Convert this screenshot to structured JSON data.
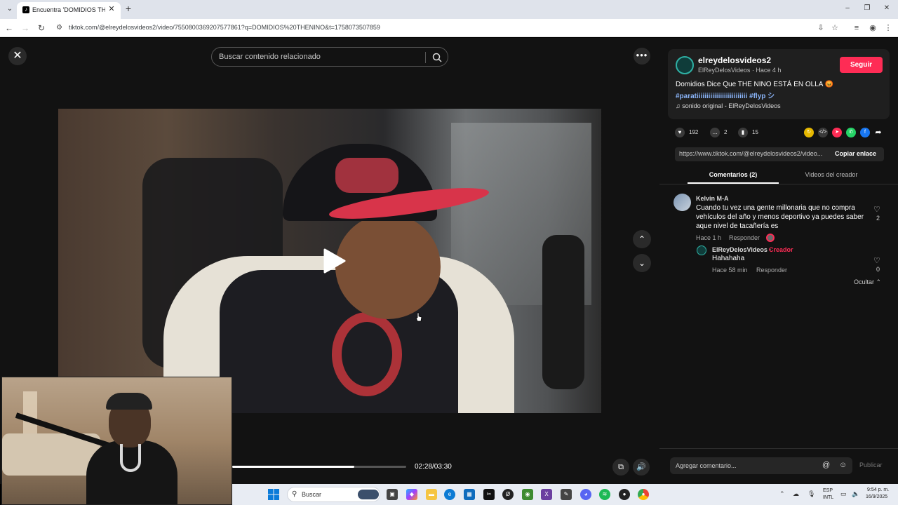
{
  "browser": {
    "tab_title": "Encuentra 'DOMIDIOS THENINO' | TikTok",
    "url": "tiktok.com/@elreydelosvideos2/video/7550800369207577861?q=DOMIDIOS%20THENINO&t=1758073507859"
  },
  "player": {
    "search_placeholder": "Buscar contenido relacionado",
    "time": "02:28/03:30",
    "progress": 0.7
  },
  "author": {
    "username": "elreydelosvideos2",
    "display": "ElReyDelosVideos · Hace 4 h",
    "follow_label": "Seguir",
    "caption": "Domidios Dice Que THE NINO ESTÁ EN OLLA 😡",
    "tags": "#paratiiiiiiiiiiiiiiiiiiiiiiiiii #flyp シ",
    "sound": "sonido original - ElReyDelosVideos"
  },
  "stats": {
    "likes": "192",
    "comments": "2",
    "saves": "15"
  },
  "link": {
    "url": "https://www.tiktok.com/@elreydelosvideos2/video...",
    "copy_label": "Copiar enlace"
  },
  "tabs": {
    "comments": "Comentarios (2)",
    "creator_videos": "Videos del creador"
  },
  "comments": [
    {
      "name": "Kelvin M-A",
      "text": "Cuando tu vez una gente millonaria que no compra vehículos del año y menos deportivo ya puedes saber aque nivel de tacañería es",
      "time": "Hace 1 h",
      "reply_label": "Responder",
      "likes": "2"
    }
  ],
  "reply": {
    "name": "ElReyDelosVideos ·",
    "badge": "Creador",
    "text": "Hahahaha",
    "time": "Hace 58 min",
    "reply_label": "Responder",
    "likes": "0",
    "hide_label": "Ocultar"
  },
  "comment_bar": {
    "placeholder": "Agregar comentario...",
    "publish_label": "Publicar"
  },
  "taskbar": {
    "search_label": "Buscar",
    "lang_top": "ESP",
    "lang_bottom": "INTL",
    "time": "9:54 p. m.",
    "date": "16/9/2025"
  },
  "colors": {
    "accent": "#fe2c55",
    "panel_bg": "#121212",
    "hashtag": "#8ab4f8"
  }
}
